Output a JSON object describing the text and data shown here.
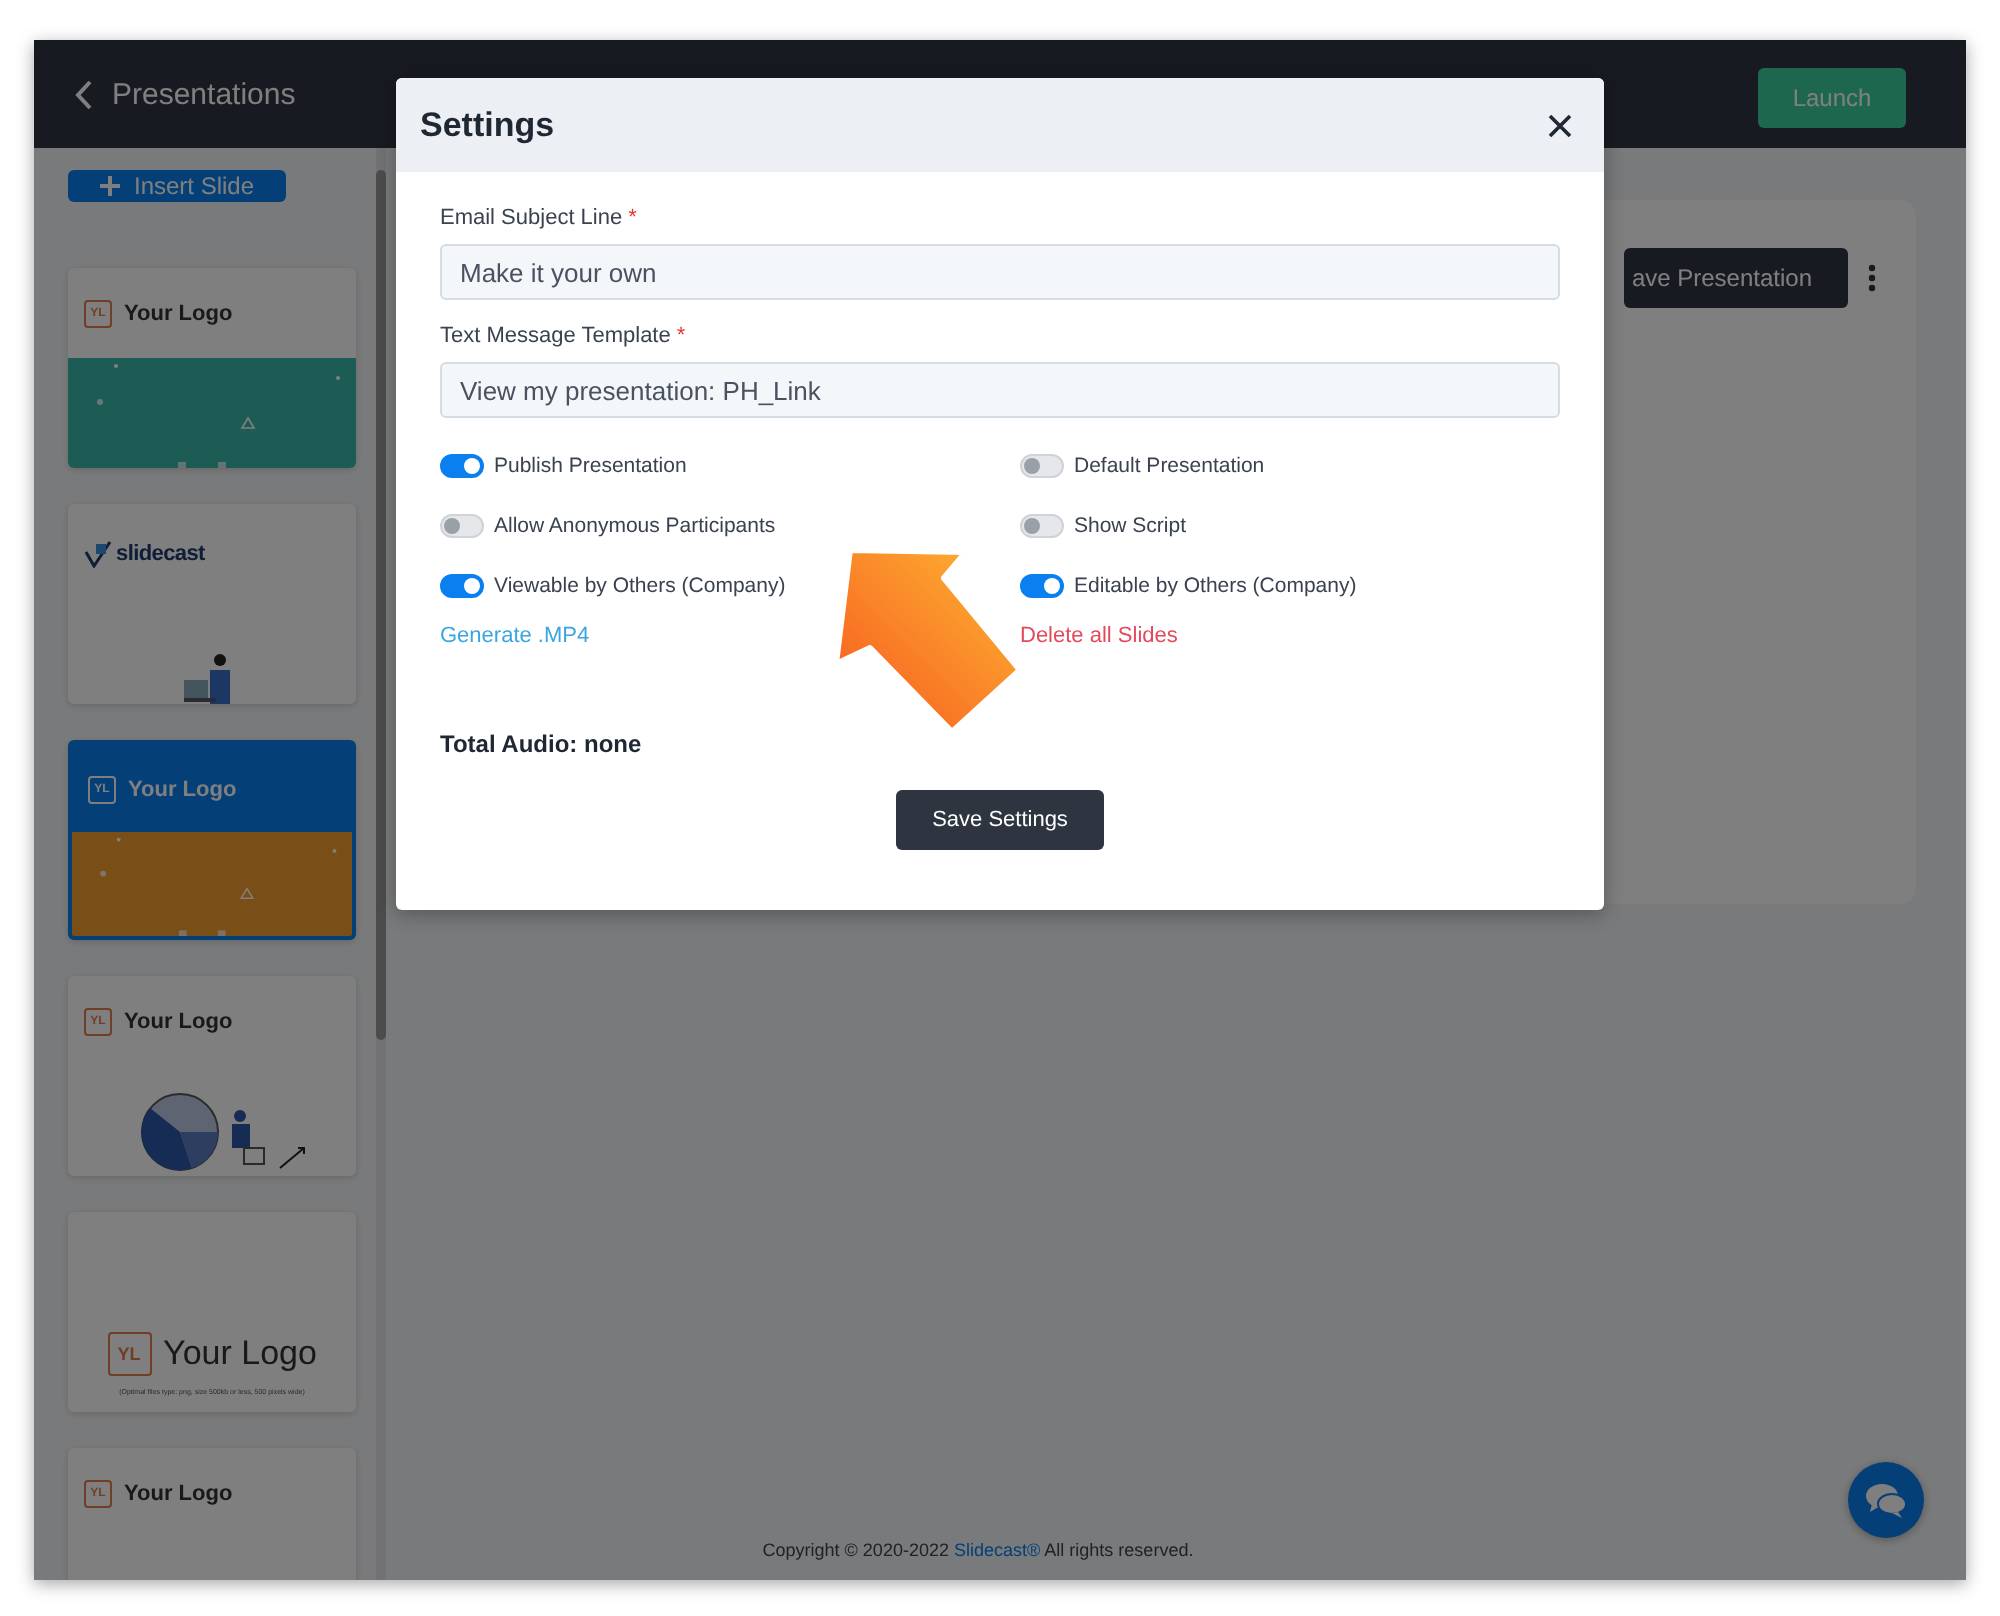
{
  "header": {
    "back_label": "Presentations",
    "launch_button": "Launch"
  },
  "sidebar": {
    "insert_button": "Insert Slide",
    "slides": [
      {
        "kind": "band",
        "logo_mark": "YL",
        "logo_text": "Your Logo",
        "selected": false
      },
      {
        "kind": "person",
        "logo_text": "slidecast",
        "selected": false
      },
      {
        "kind": "band",
        "logo_mark": "YL",
        "logo_text": "Your Logo",
        "selected": true
      },
      {
        "kind": "chart",
        "logo_mark": "YL",
        "logo_text": "Your Logo",
        "selected": false
      },
      {
        "kind": "large",
        "logo_mark": "YL",
        "logo_text": "Your Logo",
        "caption": "(Optimal files type: png, size 500kb or less, 500 pixels wide)",
        "selected": false
      },
      {
        "kind": "plain",
        "logo_mark": "YL",
        "logo_text": "Your Logo",
        "selected": false
      }
    ]
  },
  "main": {
    "save_button": "ave Presentation"
  },
  "footer": {
    "prefix": "Copyright © 2020-2022",
    "link": "Slidecast®",
    "suffix": "All rights reserved."
  },
  "modal": {
    "title": "Settings",
    "fields": [
      {
        "label": "Email Subject Line",
        "required_mark": "*",
        "value": "Make it your own"
      },
      {
        "label": "Text Message Template",
        "required_mark": "*",
        "value": "View my presentation: PH_Link"
      }
    ],
    "toggles": [
      {
        "label": "Publish Presentation",
        "on": true
      },
      {
        "label": "Default Presentation",
        "on": false
      },
      {
        "label": "Allow Anonymous Participants",
        "on": false
      },
      {
        "label": "Show Script",
        "on": false
      },
      {
        "label": "Viewable by Others (Company)",
        "on": true
      },
      {
        "label": "Editable by Others (Company)",
        "on": true
      }
    ],
    "links": [
      {
        "label": "Generate .MP4",
        "kind": "action"
      },
      {
        "label": "Delete all Slides",
        "kind": "danger"
      }
    ],
    "total_audio": "Total Audio: none",
    "save_button": "Save Settings"
  }
}
